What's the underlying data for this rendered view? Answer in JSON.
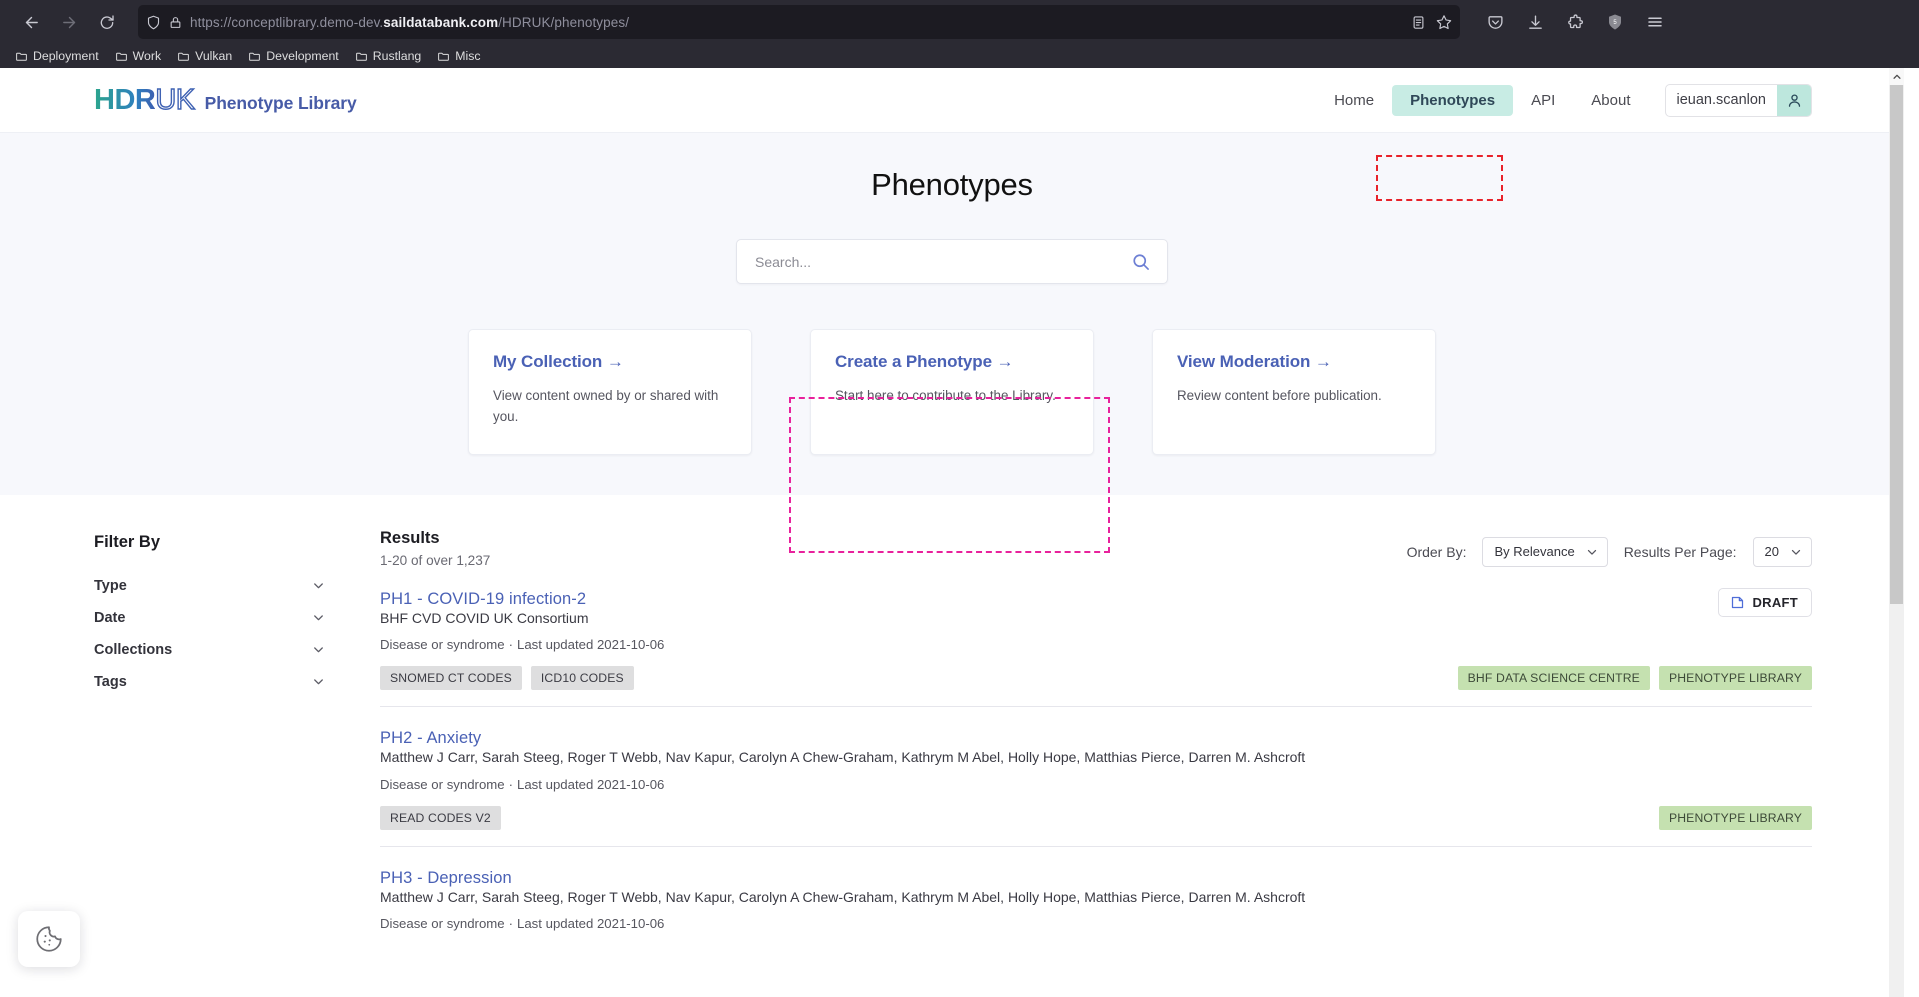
{
  "browser": {
    "back_icon": "back-arrow-icon",
    "forward_icon": "forward-arrow-icon",
    "reload_icon": "reload-icon",
    "url_prefix": "https://conceptlibrary.demo-dev.",
    "url_domain": "saildatabank.com",
    "url_suffix": "/HDRUK/phenotypes/",
    "shield_icon": "tracking-protection-shield-icon",
    "lock_icon": "padlock-icon",
    "reader_icon": "reader-view-icon",
    "bookmark_icon": "star-bookmark-icon",
    "toolbar_right_icons": [
      "pocket-icon",
      "downloads-icon",
      "extension-icon",
      "ublock-shield-icon",
      "hamburger-menu-icon"
    ],
    "bookmarks": [
      {
        "label": "Deployment"
      },
      {
        "label": "Work"
      },
      {
        "label": "Vulkan"
      },
      {
        "label": "Development"
      },
      {
        "label": "Rustlang"
      },
      {
        "label": "Misc"
      }
    ]
  },
  "header": {
    "logo_hdr": "HDR",
    "logo_uk": "UK",
    "logo_word": "Phenotype Library",
    "nav": [
      {
        "label": "Home",
        "active": false
      },
      {
        "label": "Phenotypes",
        "active": true
      },
      {
        "label": "API",
        "active": false
      },
      {
        "label": "About",
        "active": false
      }
    ],
    "user": {
      "name": "ieuan.scanlon",
      "avatar_icon": "person-avatar-icon"
    }
  },
  "hero": {
    "title": "Phenotypes",
    "search": {
      "placeholder": "Search...",
      "value": "",
      "icon": "search-magnifier-icon"
    },
    "cards": [
      {
        "title": "My Collection",
        "arrow": "→",
        "desc": "View content owned by or shared with you."
      },
      {
        "title": "Create a Phenotype",
        "arrow": "→",
        "desc": "Start here to contribute to the Library."
      },
      {
        "title": "View Moderation",
        "arrow": "→",
        "desc": "Review content before publication."
      }
    ]
  },
  "filters": {
    "title": "Filter By",
    "items": [
      {
        "label": "Type"
      },
      {
        "label": "Date"
      },
      {
        "label": "Collections"
      },
      {
        "label": "Tags"
      }
    ]
  },
  "results": {
    "title": "Results",
    "count_text": "1-20 of over 1,237",
    "order_by_label": "Order By:",
    "order_by_value": "By Relevance",
    "per_page_label": "Results Per Page:",
    "per_page_value": "20",
    "items": [
      {
        "title": "PH1 - COVID-19 infection-2",
        "authors": "BHF CVD COVID UK Consortium",
        "type": "Disease or syndrome",
        "updated": "Last updated 2021-10-06",
        "coding_chips": [
          "SNOMED CT CODES",
          "ICD10 CODES"
        ],
        "collection_chips": [
          "BHF DATA SCIENCE CENTRE",
          "PHENOTYPE LIBRARY"
        ],
        "status": "DRAFT",
        "status_icon": "draft-document-icon"
      },
      {
        "title": "PH2 - Anxiety",
        "authors": "Matthew J Carr, Sarah Steeg, Roger T Webb, Nav Kapur, Carolyn A Chew-Graham, Kathrym M Abel, Holly Hope, Matthias Pierce, Darren M. Ashcroft",
        "type": "Disease or syndrome",
        "updated": "Last updated 2021-10-06",
        "coding_chips": [
          "READ CODES V2"
        ],
        "collection_chips": [
          "PHENOTYPE LIBRARY"
        ],
        "status": "",
        "status_icon": ""
      },
      {
        "title": "PH3 - Depression",
        "authors": "Matthew J Carr, Sarah Steeg, Roger T Webb, Nav Kapur, Carolyn A Chew-Graham, Kathrym M Abel, Holly Hope, Matthias Pierce, Darren M. Ashcroft",
        "type": "Disease or syndrome",
        "updated": "Last updated 2021-10-06",
        "coding_chips": [],
        "collection_chips": [],
        "status": "",
        "status_icon": ""
      }
    ]
  },
  "overlay": {
    "cookie_icon": "cookie-consent-icon"
  },
  "colors": {
    "accent_blue": "#4a61b5",
    "nav_active_bg": "#c8ece4",
    "chip_gray": "#dededf",
    "chip_green": "#c5e1b0",
    "annotation_red": "#e8222a",
    "annotation_pink": "#e8219c"
  }
}
